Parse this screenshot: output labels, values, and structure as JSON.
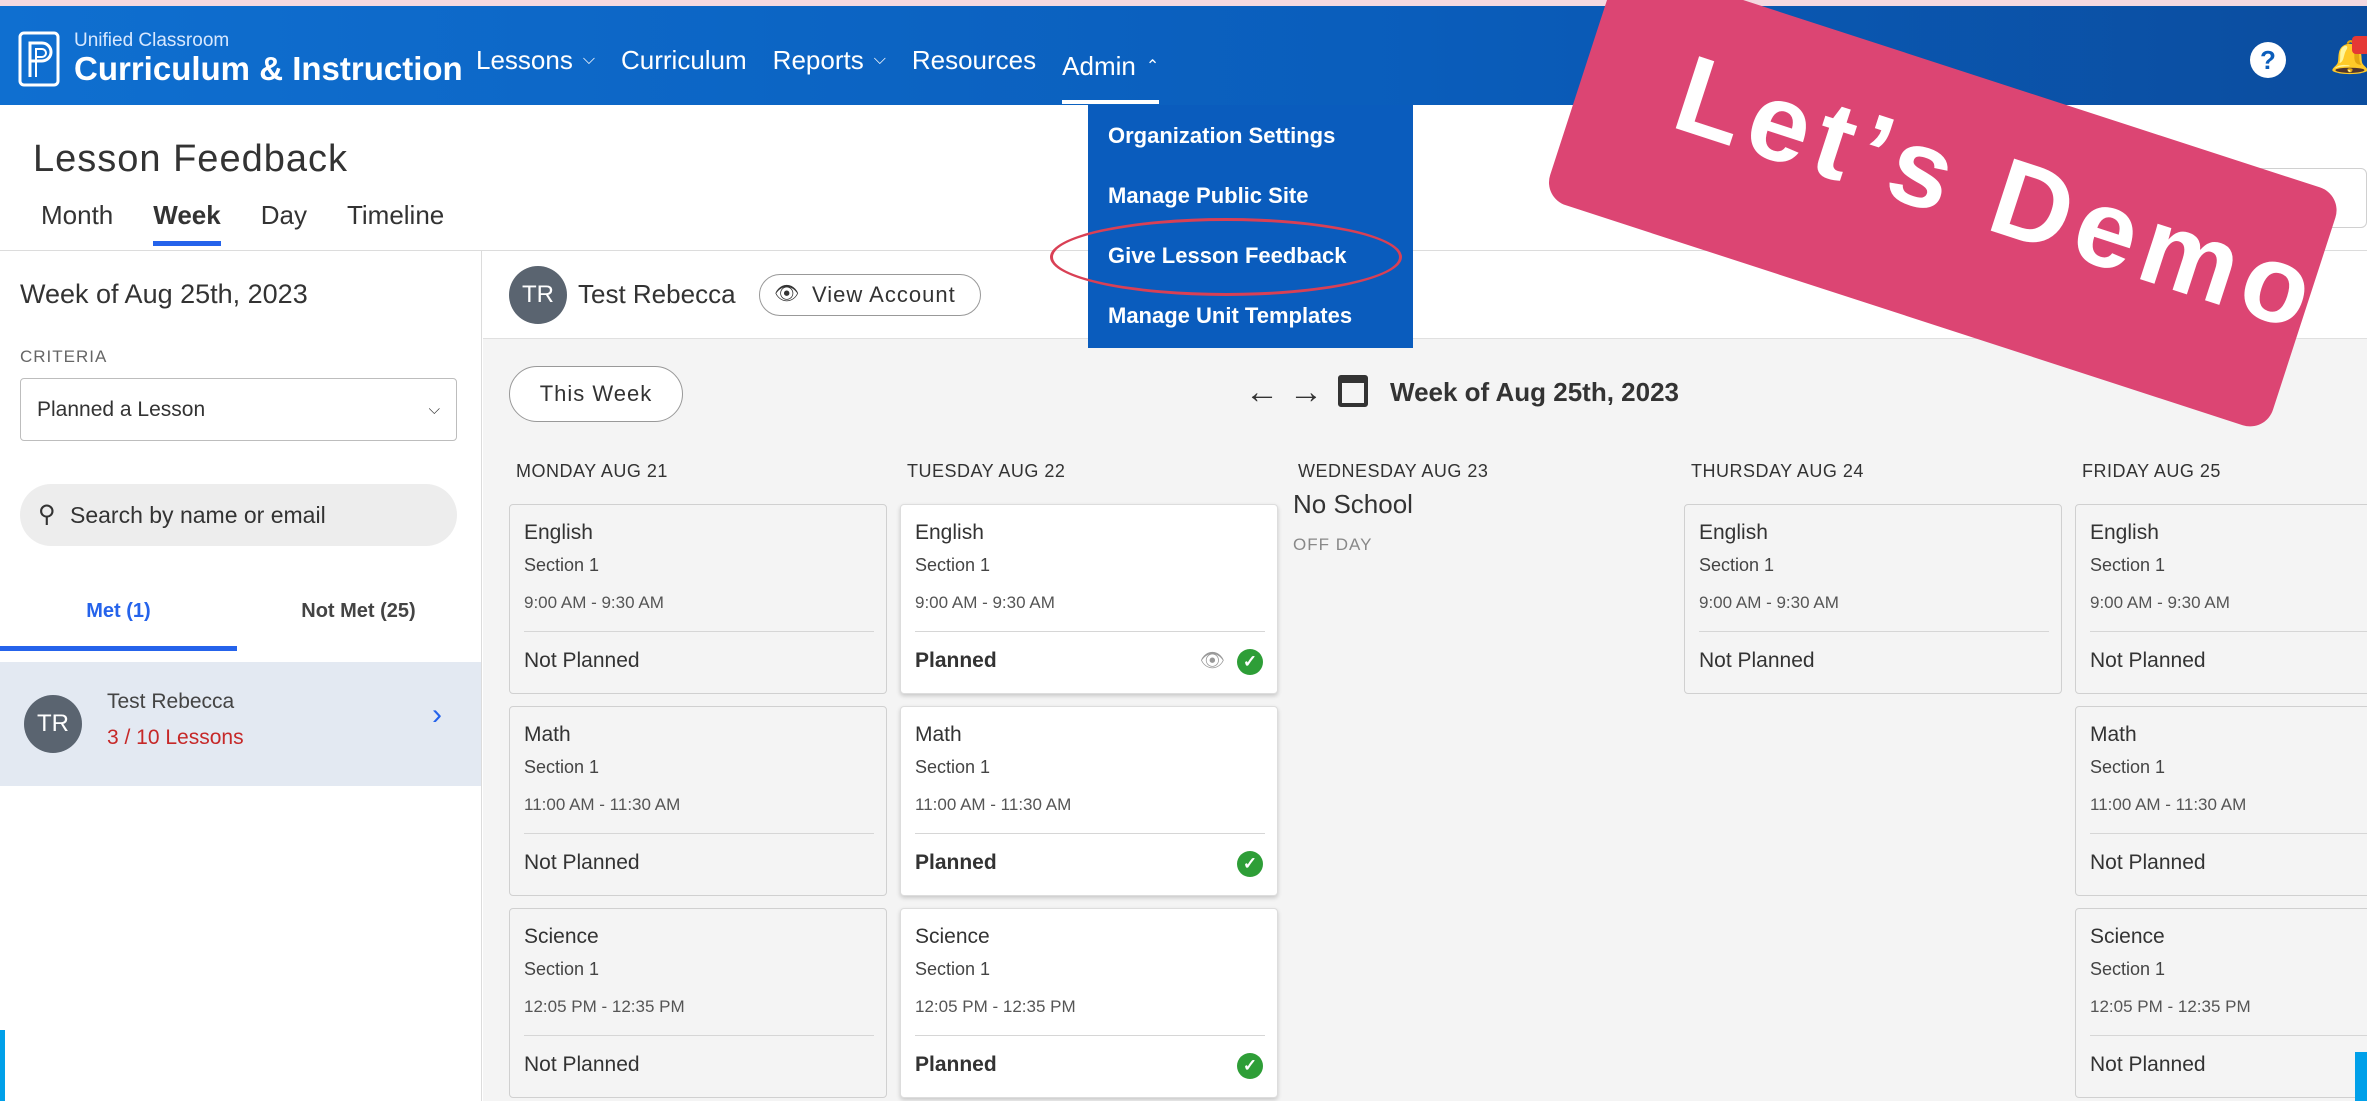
{
  "brand": {
    "sub": "Unified Classroom",
    "title": "Curriculum & Instruction"
  },
  "nav": {
    "lessons": "Lessons",
    "curriculum": "Curriculum",
    "reports": "Reports",
    "resources": "Resources",
    "admin": "Admin"
  },
  "admin_menu": {
    "items": [
      "Organization Settings",
      "Manage Public Site",
      "Give Lesson Feedback",
      "Manage Unit Templates"
    ]
  },
  "demo_banner": "Let’s Demo",
  "page": {
    "title": "Lesson Feedback",
    "tabs": [
      "Month",
      "Week",
      "Day",
      "Timeline"
    ]
  },
  "left": {
    "week_label": "Week of Aug 25th, 2023",
    "criteria_label": "CRITERIA",
    "criteria_value": "Planned a Lesson",
    "search_placeholder": "Search by name or email",
    "met_tab": "Met (1)",
    "not_met_tab": "Not Met (25)",
    "person": {
      "initials": "TR",
      "name": "Test Rebecca",
      "lessons": "3 / 10 Lessons"
    }
  },
  "main": {
    "account_initials": "TR",
    "account_name": "Test Rebecca",
    "view_account": "View Account",
    "this_week": "This Week",
    "week_label": "Week of Aug 25th, 2023",
    "days": [
      "MONDAY AUG 21",
      "TUESDAY AUG 22",
      "WEDNESDAY AUG 23",
      "THURSDAY AUG 24",
      "FRIDAY AUG 25"
    ],
    "no_school": "No School",
    "off_day": "OFF DAY",
    "lessons": {
      "english": {
        "subject": "English",
        "section": "Section 1",
        "time": "9:00 AM - 9:30 AM"
      },
      "math": {
        "subject": "Math",
        "section": "Section 1",
        "time": "11:00 AM - 11:30 AM"
      },
      "science": {
        "subject": "Science",
        "section": "Section 1",
        "time": "12:05 PM - 12:35 PM"
      }
    },
    "status_planned": "Planned",
    "status_not_planned": "Not Planned"
  },
  "colors": {
    "brand_blue": "#0a5dbb",
    "accent": "#2563eb",
    "banner": "#dc4573",
    "check": "#2e9e37"
  }
}
